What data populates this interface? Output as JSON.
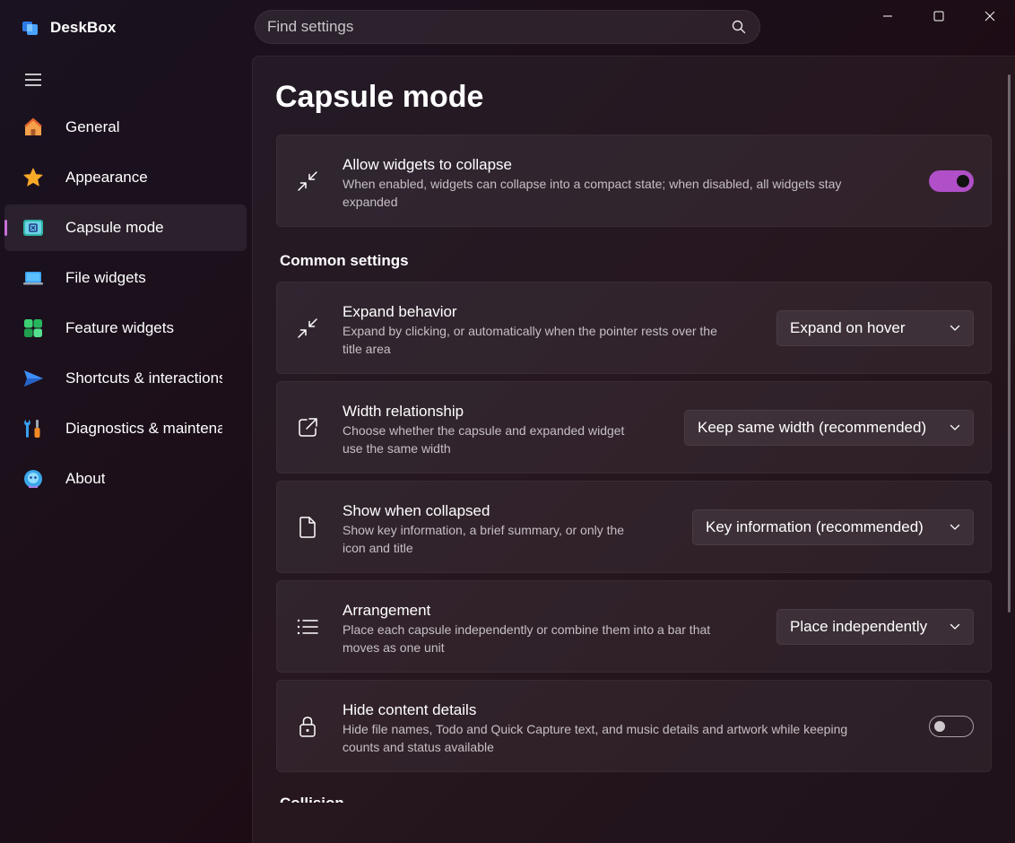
{
  "app": {
    "name": "DeskBox"
  },
  "search": {
    "placeholder": "Find settings"
  },
  "sidebar": {
    "items": [
      {
        "label": "General",
        "icon": "home-icon"
      },
      {
        "label": "Appearance",
        "icon": "star-icon"
      },
      {
        "label": "Capsule mode",
        "icon": "capsule-icon",
        "active": true
      },
      {
        "label": "File widgets",
        "icon": "laptop-icon"
      },
      {
        "label": "Feature widgets",
        "icon": "widgets-icon"
      },
      {
        "label": "Shortcuts & interactions",
        "icon": "send-icon"
      },
      {
        "label": "Diagnostics & maintenance",
        "icon": "tools-icon"
      },
      {
        "label": "About",
        "icon": "bot-icon"
      }
    ]
  },
  "main": {
    "title": "Capsule mode",
    "collapse": {
      "title": "Allow widgets to collapse",
      "desc_line1": "When enabled, widgets can collapse into a compact state; when disabled, all widgets stay",
      "desc_line2": "expanded",
      "toggle_on": true
    },
    "section_title": "Common settings",
    "expand": {
      "title": "Expand behavior",
      "desc_line1": "Expand by clicking, or automatically when the pointer rests over the",
      "desc_line2": "title area",
      "value": "Expand on hover"
    },
    "width": {
      "title": "Width relationship",
      "desc_line1": "Choose whether the capsule and expanded widget",
      "desc_line2": "use the same width",
      "value": "Keep same width (recommended)"
    },
    "show": {
      "title": "Show when collapsed",
      "desc_line1": "Show key information, a brief summary, or only the",
      "desc_line2": "icon and title",
      "value": "Key information (recommended)"
    },
    "arrangement": {
      "title": "Arrangement",
      "desc_line1": "Place each capsule independently or combine them into a bar that",
      "desc_line2": "moves as one unit",
      "value": "Place independently"
    },
    "hide": {
      "title": "Hide content details",
      "desc_line1": "Hide file names, Todo and Quick Capture text, and music details and artwork while keeping",
      "desc_line2": "counts and status available",
      "toggle_on": false
    },
    "next_section_partial": "Collision"
  },
  "colors": {
    "accent": "#b04fc8",
    "active_indicator": "#c86fd8"
  }
}
